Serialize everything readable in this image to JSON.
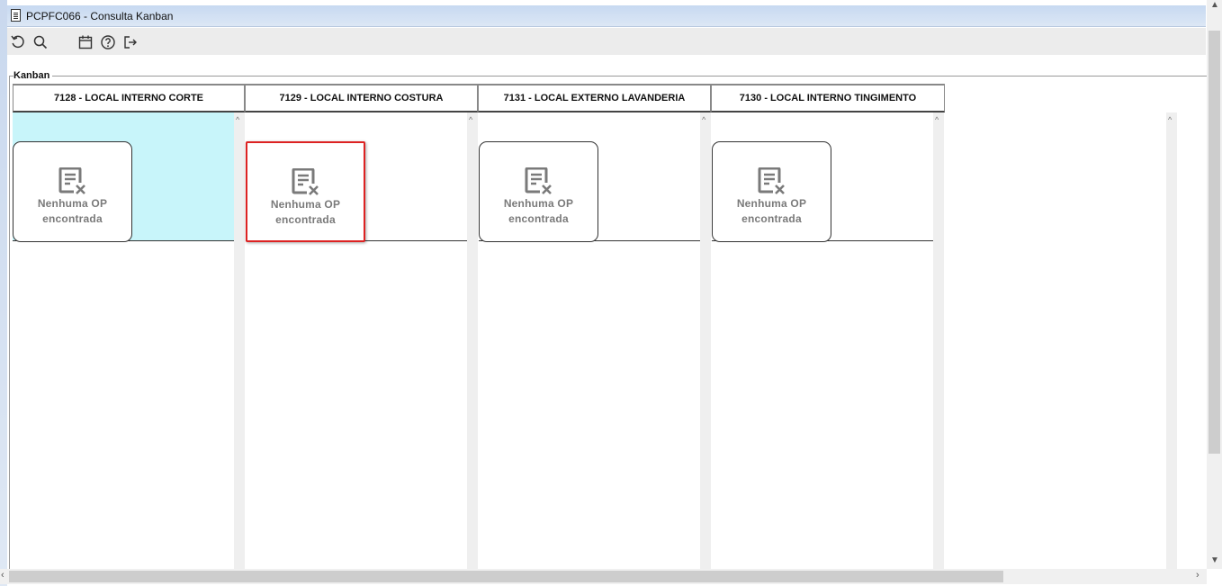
{
  "window": {
    "title": "PCPFC066 - Consulta Kanban"
  },
  "toolbar": {
    "buttons": [
      {
        "icon": "refresh-icon"
      },
      {
        "icon": "search-icon"
      },
      {
        "icon": "calendar-icon"
      },
      {
        "icon": "help-icon"
      },
      {
        "icon": "exit-icon"
      }
    ]
  },
  "kanban": {
    "label": "Kanban",
    "columns": [
      {
        "header": "7128 - LOCAL INTERNO CORTE",
        "empty_line1": "Nenhuma OP",
        "empty_line2": "encontrada",
        "selected": true,
        "focused": false
      },
      {
        "header": "7129 - LOCAL INTERNO COSTURA",
        "empty_line1": "Nenhuma OP",
        "empty_line2": "encontrada",
        "selected": false,
        "focused": true
      },
      {
        "header": "7131 - LOCAL EXTERNO LAVANDERIA",
        "empty_line1": "Nenhuma OP",
        "empty_line2": "encontrada",
        "selected": false,
        "focused": false
      },
      {
        "header": "7130 - LOCAL INTERNO TINGIMENTO",
        "empty_line1": "Nenhuma OP",
        "empty_line2": "encontrada",
        "selected": false,
        "focused": false
      }
    ]
  },
  "colors": {
    "selected_band": "#c8f5fa",
    "focus_border": "#dd2222",
    "empty_text": "#7a7a7a"
  }
}
